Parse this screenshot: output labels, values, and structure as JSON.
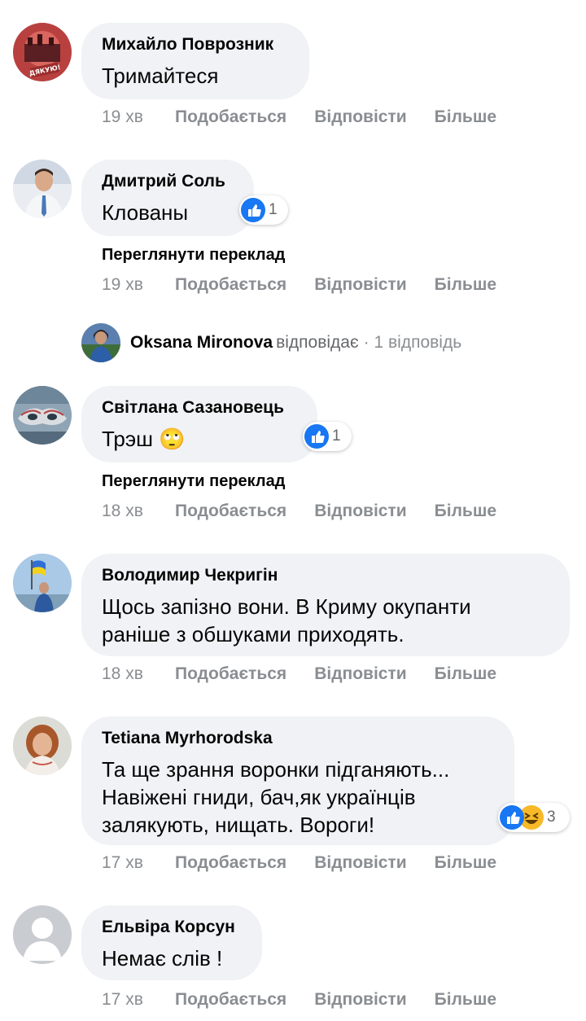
{
  "comments": [
    {
      "author": "Михайло Поврозник",
      "text": "Тримайтеся",
      "time": "19 хв",
      "avatar_text": "ДЯКУЮ!"
    },
    {
      "author": "Дмитрий Соль",
      "text": "Клованы",
      "time": "19 хв",
      "reactions": "1",
      "translate": "Переглянути переклад"
    },
    {
      "author": "Світлана Сазановець",
      "text": "Трэш 🙄",
      "time": "18 хв",
      "reactions": "1",
      "translate": "Переглянути переклад"
    },
    {
      "author": "Володимир Чекригін",
      "text_lines": [
        "Щось запізно вони. В Криму окупанти",
        "раніше з обшуками приходять."
      ],
      "time": "18 хв"
    },
    {
      "author": "Tetiana Myrhorodska",
      "text_lines": [
        "Та ще зрання воронки підганяють...",
        "Навіжені гниди, бач,як українців",
        "залякують, нищать. Вороги!"
      ],
      "time": "17 хв",
      "reactions": "3"
    },
    {
      "author": "Ельвіра Корсун",
      "text": "Немає слів !",
      "time": "17 хв"
    }
  ],
  "actions": {
    "like": "Подобається",
    "reply": "Відповісти",
    "more": "Більше"
  },
  "reply_summary": {
    "name": "Oksana Mironova",
    "verb": "відповідає",
    "count": "· 1 відповідь"
  },
  "colors": {
    "like_blue": "#1877f2",
    "bubble": "#f0f2f5",
    "meta_gray": "#8a8d91"
  }
}
